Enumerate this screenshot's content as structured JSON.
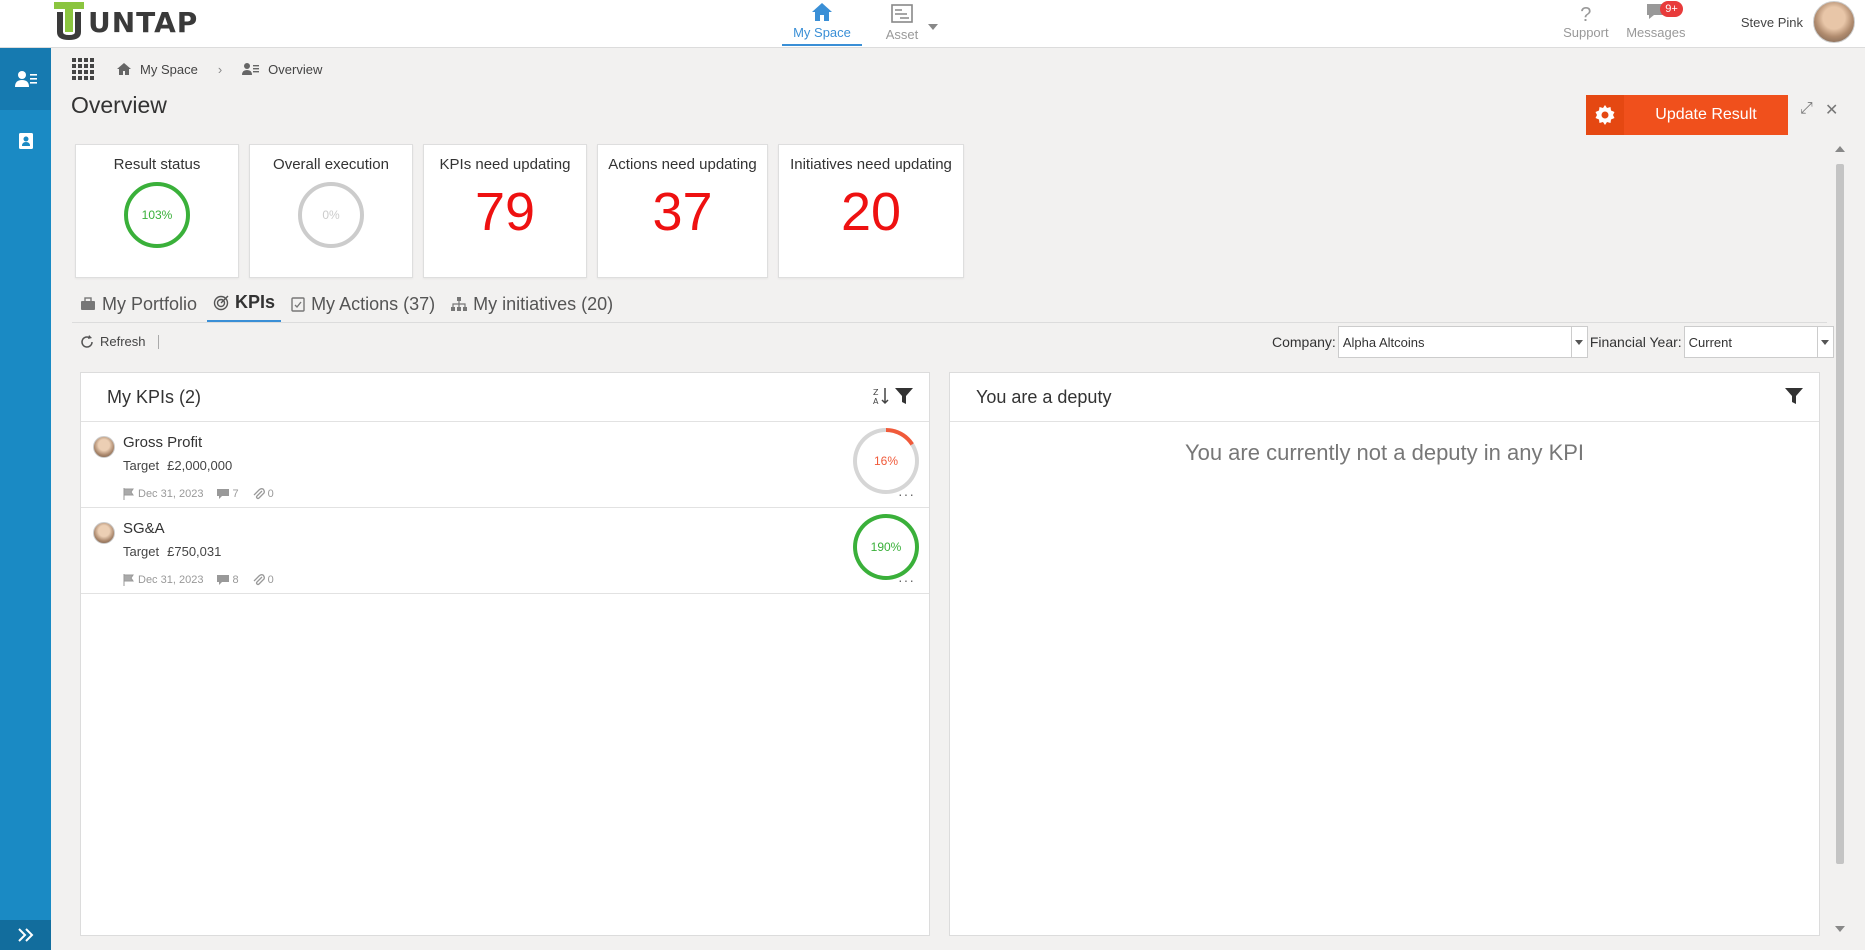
{
  "app": {
    "logo_text": "UNTAP"
  },
  "topnav": [
    {
      "label": "My Space",
      "active": true
    },
    {
      "label": "Asset",
      "active": false
    }
  ],
  "utilities": {
    "support_label": "Support",
    "messages_label": "Messages",
    "messages_badge": "9+"
  },
  "user": {
    "name": "Steve Pink"
  },
  "breadcrumb": {
    "home": "My Space",
    "current": "Overview"
  },
  "page": {
    "title": "Overview",
    "update_button": "Update Result"
  },
  "stats": {
    "result_status": {
      "title": "Result status",
      "value": "103%",
      "percent": 103
    },
    "overall_execution": {
      "title": "Overall execution",
      "value": "0%",
      "percent": 0
    },
    "kpis_need_updating": {
      "title": "KPIs need updating",
      "value": "79"
    },
    "actions_need_updating": {
      "title": "Actions need updating",
      "value": "37"
    },
    "initiatives_need_updating": {
      "title": "Initiatives need updating",
      "value": "20"
    }
  },
  "tabs": [
    {
      "label": "My Portfolio",
      "active": false
    },
    {
      "label": "KPIs",
      "active": true
    },
    {
      "label": "My Actions (37)",
      "active": false
    },
    {
      "label": "My initiatives (20)",
      "active": false
    }
  ],
  "toolbar": {
    "refresh_label": "Refresh"
  },
  "filters": {
    "company_label": "Company:",
    "company_value": "Alpha Altcoins",
    "year_label": "Financial Year:",
    "year_value": "Current"
  },
  "my_kpis": {
    "title": "My KPIs (2)",
    "items": [
      {
        "name": "Gross Profit",
        "target_label": "Target",
        "target_value": "£2,000,000",
        "date": "Dec 31, 2023",
        "comments": "7",
        "attachments": "0",
        "progress": "16%",
        "progress_percent": 16,
        "status_color": "#f05a3a"
      },
      {
        "name": "SG&A",
        "target_label": "Target",
        "target_value": "£750,031",
        "date": "Dec 31, 2023",
        "comments": "8",
        "attachments": "0",
        "progress": "190%",
        "progress_percent": 190,
        "status_color": "#3ab03a"
      }
    ]
  },
  "deputy": {
    "title": "You are a deputy",
    "empty_message": "You are currently not a deputy in any KPI"
  },
  "colors": {
    "accent": "#3a8fd6",
    "sidebar": "#1a8ac4",
    "update_button": "#f0501c",
    "stat_number": "#ee1111",
    "ring_green": "#3ab03a",
    "ring_grey": "#cccccc",
    "ring_red": "#f05a3a"
  }
}
